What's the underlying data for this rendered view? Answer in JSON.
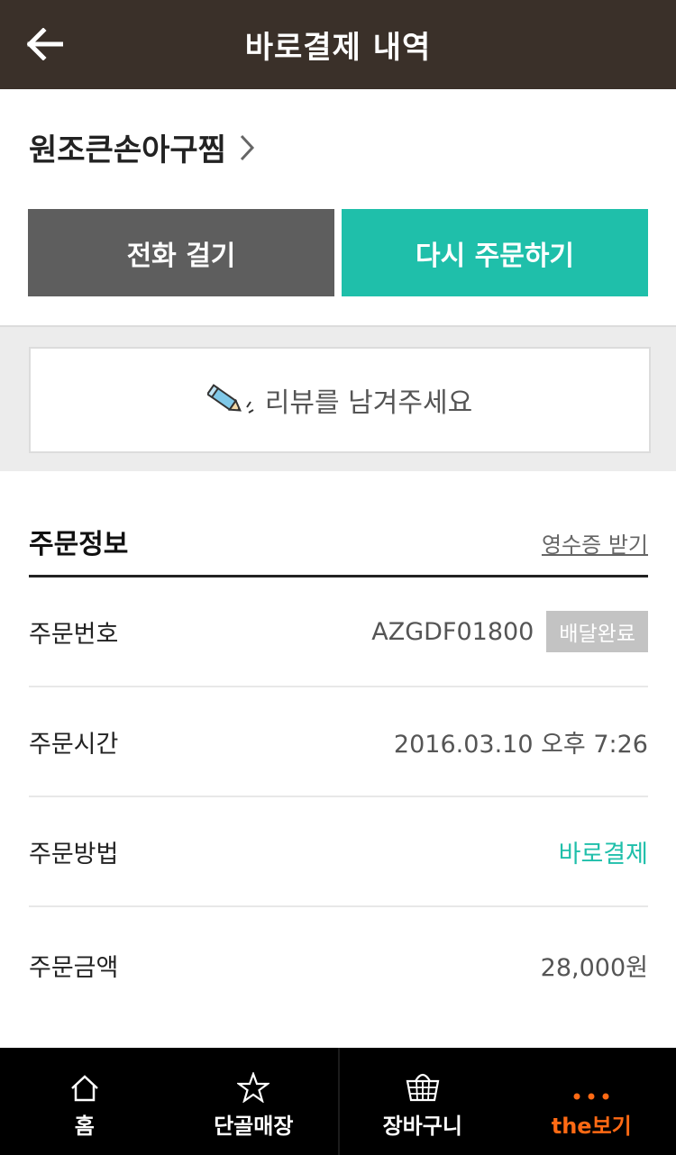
{
  "header": {
    "title": "바로결제 내역",
    "back_icon": "arrow-left-icon"
  },
  "store": {
    "name": "원조큰손아구찜",
    "chevron_icon": "chevron-right-icon"
  },
  "actions": {
    "call_label": "전화 걸기",
    "reorder_label": "다시 주문하기"
  },
  "review": {
    "prompt": "리뷰를 남겨주세요",
    "icon": "pencil-icon"
  },
  "order_info": {
    "title": "주문정보",
    "receipt_link": "영수증 받기",
    "rows": [
      {
        "label": "주문번호",
        "value": "AZGDF01800",
        "badge": "배달완료"
      },
      {
        "label": "주문시간",
        "value": "2016.03.10 오후 7:26"
      },
      {
        "label": "주문방법",
        "value": "바로결제"
      },
      {
        "label": "주문금액",
        "value": "28,000원"
      }
    ]
  },
  "bottom_nav": {
    "items": [
      {
        "label": "홈",
        "icon": "home-icon"
      },
      {
        "label": "단골매장",
        "icon": "star-icon"
      },
      {
        "label": "장바구니",
        "icon": "basket-icon"
      },
      {
        "label": "the보기",
        "icon": "more-dots-icon"
      }
    ],
    "active_index": 3
  },
  "colors": {
    "header_bg": "#3a3029",
    "accent": "#1fbfaa",
    "call_button": "#5e5e5e",
    "nav_active": "#ff6a14",
    "badge_bg": "#c3c3c3"
  }
}
